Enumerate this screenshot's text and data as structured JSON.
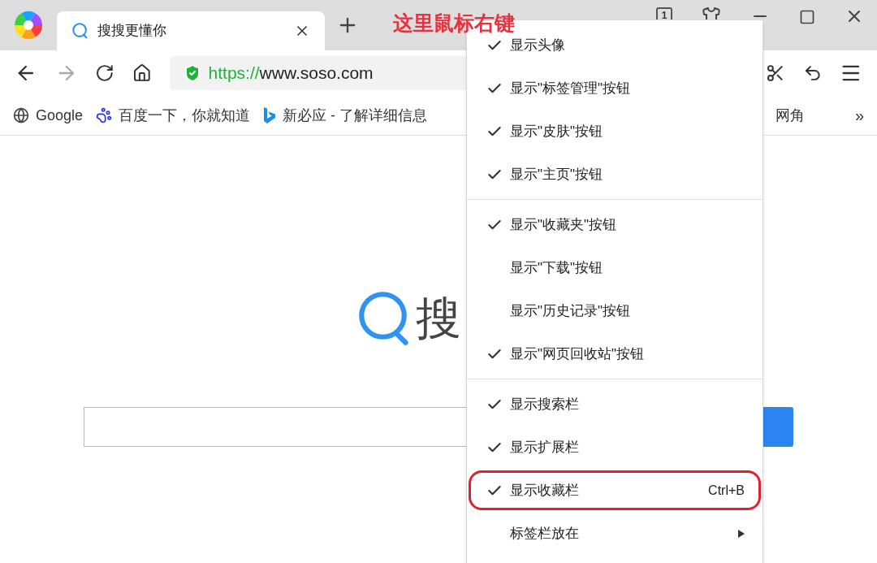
{
  "annotation": "这里鼠标右键",
  "tab": {
    "title": "搜搜更懂你",
    "selected": true
  },
  "titlebar": {
    "tab_count": "1"
  },
  "address": {
    "scheme": "https://",
    "host": "www.soso.com"
  },
  "bookmarks": [
    {
      "kind": "globe",
      "label": "Google"
    },
    {
      "kind": "paw",
      "label": "百度一下，你就知道"
    },
    {
      "kind": "bing",
      "label": "新必应 - 了解详细信息"
    },
    {
      "kind": "none",
      "label": "网角"
    }
  ],
  "bookmarks_more": "»",
  "page": {
    "logo_text": "搜"
  },
  "menu": {
    "groups": [
      {
        "items": [
          {
            "label": "显示头像",
            "checked": true,
            "highlighted": false,
            "submenu": false
          },
          {
            "label": "显示\"标签管理\"按钮",
            "checked": true,
            "highlighted": false,
            "submenu": false
          },
          {
            "label": "显示\"皮肤\"按钮",
            "checked": true,
            "highlighted": false,
            "submenu": false
          },
          {
            "label": "显示\"主页\"按钮",
            "checked": true,
            "highlighted": false,
            "submenu": false
          }
        ]
      },
      {
        "items": [
          {
            "label": "显示\"收藏夹\"按钮",
            "checked": true,
            "highlighted": false,
            "submenu": false
          },
          {
            "label": "显示\"下载\"按钮",
            "checked": false,
            "highlighted": false,
            "submenu": false
          },
          {
            "label": "显示\"历史记录\"按钮",
            "checked": false,
            "highlighted": false,
            "submenu": false
          },
          {
            "label": "显示\"网页回收站\"按钮",
            "checked": true,
            "highlighted": false,
            "submenu": false
          }
        ]
      },
      {
        "items": [
          {
            "label": "显示搜索栏",
            "checked": true,
            "highlighted": false,
            "submenu": false
          },
          {
            "label": "显示扩展栏",
            "checked": true,
            "highlighted": false,
            "submenu": false
          },
          {
            "label": "显示收藏栏",
            "checked": true,
            "highlighted": true,
            "submenu": false,
            "shortcut": "Ctrl+B"
          },
          {
            "label": "标签栏放在",
            "checked": false,
            "highlighted": false,
            "submenu": true
          }
        ]
      }
    ]
  }
}
